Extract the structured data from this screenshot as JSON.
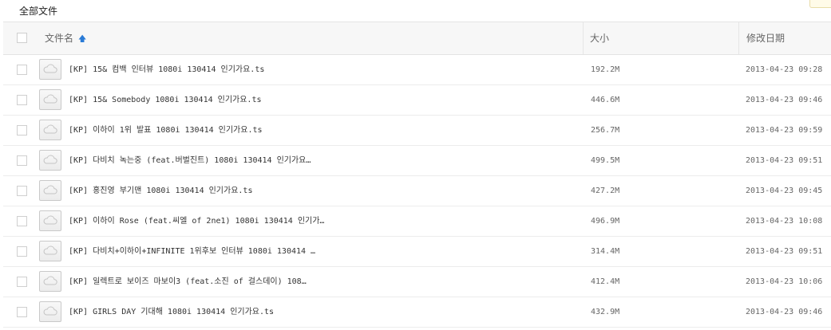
{
  "breadcrumb": {
    "label": "全部文件"
  },
  "header": {
    "name_label": "文件名",
    "sort_icon": "sort-up-arrow-icon",
    "size_label": "大小",
    "date_label": "修改日期"
  },
  "files": [
    {
      "name": "[KP] 15& 컴백 인터뷰 1080i 130414 인기가요.ts",
      "size": "192.2M",
      "date": "2013-04-23 09:28"
    },
    {
      "name": "[KP] 15& Somebody 1080i 130414 인기가요.ts",
      "size": "446.6M",
      "date": "2013-04-23 09:46"
    },
    {
      "name": "[KP] 이하이 1위 발표 1080i 130414 인기가요.ts",
      "size": "256.7M",
      "date": "2013-04-23 09:59"
    },
    {
      "name": "[KP] 다비치 녹는중 (feat.버벌진트) 1080i 130414 인기가요…",
      "size": "499.5M",
      "date": "2013-04-23 09:51"
    },
    {
      "name": "[KP] 홍진영 부기맨 1080i 130414 인기가요.ts",
      "size": "427.2M",
      "date": "2013-04-23 09:45"
    },
    {
      "name": "[KP] 이하이 Rose (feat.씨엘 of 2ne1) 1080i 130414 인기가…",
      "size": "496.9M",
      "date": "2013-04-23 10:08"
    },
    {
      "name": "[KP] 다비치+이하이+INFINITE 1위후보 인터뷰 1080i 130414 …",
      "size": "314.4M",
      "date": "2013-04-23 09:51"
    },
    {
      "name": "[KP] 일렉트로 보이즈 마보이3 (feat.소진 of 걸스데이) 108…",
      "size": "412.4M",
      "date": "2013-04-23 10:06"
    },
    {
      "name": "[KP] GIRLS DAY 기대해 1080i 130414 인기가요.ts",
      "size": "432.9M",
      "date": "2013-04-23 09:46"
    }
  ]
}
